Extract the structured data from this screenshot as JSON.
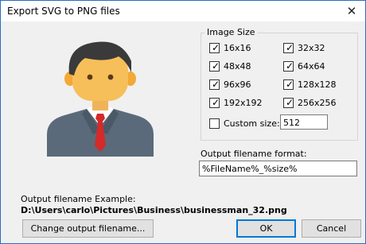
{
  "window": {
    "title": "Export SVG to PNG files"
  },
  "image_size": {
    "legend": "Image Size",
    "options": [
      {
        "label": "16x16",
        "checked": true
      },
      {
        "label": "32x32",
        "checked": true
      },
      {
        "label": "48x48",
        "checked": true
      },
      {
        "label": "64x64",
        "checked": true
      },
      {
        "label": "96x96",
        "checked": true
      },
      {
        "label": "128x128",
        "checked": true
      },
      {
        "label": "192x192",
        "checked": true
      },
      {
        "label": "256x256",
        "checked": true
      }
    ],
    "custom_size": {
      "label": "Custom size:",
      "checked": false,
      "value": "512"
    }
  },
  "output_format": {
    "label": "Output filename format:",
    "value": "%FileName%_%size%"
  },
  "example": {
    "label": "Output filename Example:",
    "path": "D:\\Users\\carlo\\Pictures\\Business\\businessman_32.png"
  },
  "buttons": {
    "change": "Change output filename...",
    "ok": "OK",
    "cancel": "Cancel"
  },
  "icons": {
    "close": "close-icon",
    "illustration": "businessman-icon",
    "check": "✓"
  }
}
